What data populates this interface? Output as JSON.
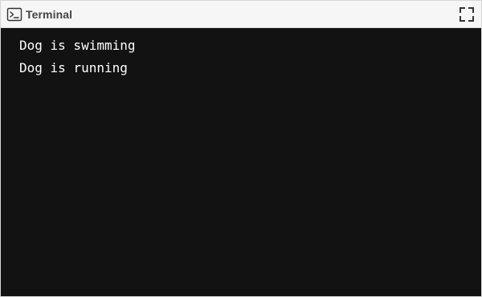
{
  "window": {
    "title": "Terminal",
    "title_icon": "terminal-icon",
    "action_icon": "fullscreen-icon"
  },
  "terminal": {
    "lines": [
      "Dog is swimming",
      "Dog is running"
    ]
  },
  "colors": {
    "title_bar_bg": "#f6f6f6",
    "terminal_bg": "#121212",
    "terminal_text": "#ffffff",
    "title_text": "#444444"
  }
}
